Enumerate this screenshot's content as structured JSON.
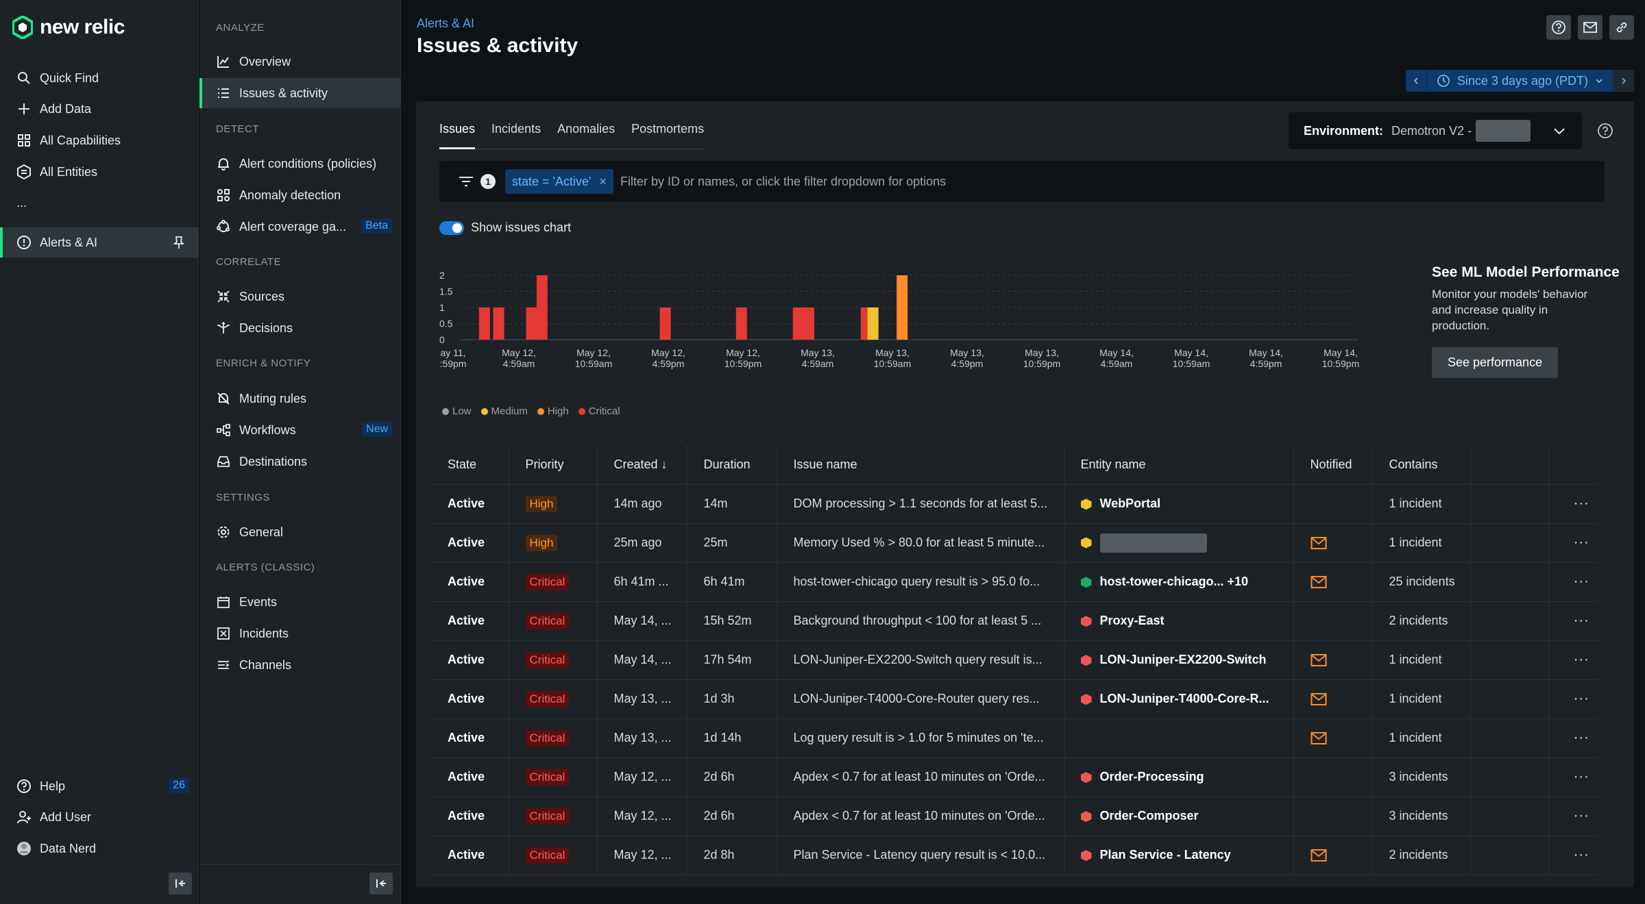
{
  "brand": {
    "name": "new relic"
  },
  "nav_primary": {
    "items": [
      {
        "label": "Quick Find",
        "icon": "search-icon"
      },
      {
        "label": "Add Data",
        "icon": "plus-icon"
      },
      {
        "label": "All Capabilities",
        "icon": "grid-icon"
      },
      {
        "label": "All Entities",
        "icon": "entities-icon"
      },
      {
        "label": "...",
        "icon": "more-icon"
      },
      {
        "label": "Alerts & AI",
        "icon": "alert-circle-icon"
      }
    ],
    "bottom": [
      {
        "label": "Help",
        "icon": "help-icon",
        "badge": "26"
      },
      {
        "label": "Add User",
        "icon": "add-user-icon"
      },
      {
        "label": "Data Nerd",
        "icon": "avatar"
      }
    ]
  },
  "nav_secondary": {
    "sections": [
      {
        "title": "ANALYZE",
        "items": [
          {
            "label": "Overview",
            "icon": "chart-icon"
          },
          {
            "label": "Issues & activity",
            "icon": "list-icon"
          }
        ]
      },
      {
        "title": "DETECT",
        "items": [
          {
            "label": "Alert conditions (policies)",
            "icon": "bell-icon"
          },
          {
            "label": "Anomaly detection",
            "icon": "anomaly-icon"
          },
          {
            "label": "Alert coverage ga...",
            "icon": "coverage-icon",
            "tag": "Beta"
          }
        ]
      },
      {
        "title": "CORRELATE",
        "items": [
          {
            "label": "Sources",
            "icon": "sources-icon"
          },
          {
            "label": "Decisions",
            "icon": "decisions-icon"
          }
        ]
      },
      {
        "title": "ENRICH & NOTIFY",
        "items": [
          {
            "label": "Muting rules",
            "icon": "bell-off-icon"
          },
          {
            "label": "Workflows",
            "icon": "workflow-icon",
            "tag": "New"
          },
          {
            "label": "Destinations",
            "icon": "inbox-icon"
          }
        ]
      },
      {
        "title": "SETTINGS",
        "items": [
          {
            "label": "General",
            "icon": "gear-icon"
          }
        ]
      },
      {
        "title": "ALERTS (CLASSIC)",
        "items": [
          {
            "label": "Events",
            "icon": "calendar-icon"
          },
          {
            "label": "Incidents",
            "icon": "incident-icon"
          },
          {
            "label": "Channels",
            "icon": "channels-icon"
          }
        ]
      }
    ]
  },
  "header": {
    "breadcrumb": "Alerts & AI",
    "title": "Issues & activity",
    "time_range": "Since 3 days ago (PDT)"
  },
  "tabs": [
    "Issues",
    "Incidents",
    "Anomalies",
    "Postmortems"
  ],
  "environment": {
    "label": "Environment:",
    "value": "Demotron V2 -"
  },
  "filter": {
    "count": "1",
    "chip": "state = 'Active'",
    "placeholder": "Filter by ID or names, or click the filter dropdown for options"
  },
  "toggle": {
    "label": "Show issues chart",
    "on": true
  },
  "promo": {
    "title": "See ML Model Performance",
    "description": "Monitor your models' behavior and increase quality in production.",
    "button": "See performance"
  },
  "colors": {
    "accent": "#1ce783",
    "link": "#4aa3ff",
    "low": "#9aa0a6",
    "medium": "#f2c12e",
    "high": "#ff8b2b",
    "critical": "#e53935"
  },
  "chart_data": {
    "type": "bar",
    "y_ticks": [
      "2",
      "1.5",
      "1",
      "0.5",
      "0"
    ],
    "ylim": [
      0,
      2
    ],
    "x_ticks": [
      [
        "ay 11,",
        ":59pm"
      ],
      [
        "May 12,",
        "4:59am"
      ],
      [
        "May 12,",
        "10:59am"
      ],
      [
        "May 12,",
        "4:59pm"
      ],
      [
        "May 12,",
        "10:59pm"
      ],
      [
        "May 13,",
        "4:59am"
      ],
      [
        "May 13,",
        "10:59am"
      ],
      [
        "May 13,",
        "4:59pm"
      ],
      [
        "May 13,",
        "10:59pm"
      ],
      [
        "May 14,",
        "4:59am"
      ],
      [
        "May 14,",
        "10:59am"
      ],
      [
        "May 14,",
        "4:59pm"
      ],
      [
        "May 14,",
        "10:59pm"
      ]
    ],
    "bars": [
      {
        "x": 0.54,
        "value": 1,
        "level": "critical"
      },
      {
        "x": 0.73,
        "value": 1,
        "level": "critical"
      },
      {
        "x": 1.17,
        "value": 1,
        "level": "critical"
      },
      {
        "x": 1.31,
        "value": 2,
        "level": "critical"
      },
      {
        "x": 2.96,
        "value": 1,
        "level": "critical"
      },
      {
        "x": 3.98,
        "value": 1,
        "level": "critical"
      },
      {
        "x": 4.74,
        "value": 1,
        "level": "critical"
      },
      {
        "x": 4.88,
        "value": 1,
        "level": "critical"
      },
      {
        "x": 5.65,
        "value": 1,
        "level": "critical"
      },
      {
        "x": 5.74,
        "value": 1,
        "level": "medium"
      },
      {
        "x": 6.13,
        "value": 2,
        "level": "high"
      }
    ],
    "legend": [
      {
        "label": "Low",
        "level": "low"
      },
      {
        "label": "Medium",
        "level": "medium"
      },
      {
        "label": "High",
        "level": "high"
      },
      {
        "label": "Critical",
        "level": "critical"
      }
    ]
  },
  "table": {
    "columns": [
      "State",
      "Priority",
      "Created ↓",
      "Duration",
      "Issue name",
      "Entity name",
      "Notified",
      "Contains"
    ],
    "rows": [
      {
        "state": "Active",
        "priority": "High",
        "created": "14m ago",
        "duration": "14m",
        "issue": "DOM processing > 1.1 seconds for at least 5...",
        "entity": "WebPortal",
        "entity_color": "#f2c12e",
        "notified": false,
        "contains": "1 incident"
      },
      {
        "state": "Active",
        "priority": "High",
        "created": "25m ago",
        "duration": "25m",
        "issue": "Memory Used % > 80.0 for at least 5 minute...",
        "entity": "",
        "entity_color": "#f2c12e",
        "redacted": true,
        "notified": true,
        "contains": "1 incident"
      },
      {
        "state": "Active",
        "priority": "Critical",
        "created": "6h 41m ...",
        "duration": "6h 41m",
        "issue": "host-tower-chicago query result is > 95.0 fo...",
        "entity": "host-tower-chicago... +10",
        "entity_color": "#1ea865",
        "notified": true,
        "contains": "25 incidents"
      },
      {
        "state": "Active",
        "priority": "Critical",
        "created": "May 14, ...",
        "duration": "15h 52m",
        "issue": "Background throughput < 100 for at least 5 ...",
        "entity": "Proxy-East",
        "entity_color": "#f0574f",
        "notified": false,
        "contains": "2 incidents"
      },
      {
        "state": "Active",
        "priority": "Critical",
        "created": "May 14, ...",
        "duration": "17h 54m",
        "issue": "LON-Juniper-EX2200-Switch query result is...",
        "entity": "LON-Juniper-EX2200-Switch",
        "entity_color": "#f0574f",
        "notified": true,
        "contains": "1 incident"
      },
      {
        "state": "Active",
        "priority": "Critical",
        "created": "May 13, ...",
        "duration": "1d 3h",
        "issue": "LON-Juniper-T4000-Core-Router query res...",
        "entity": "LON-Juniper-T4000-Core-R...",
        "entity_color": "#f0574f",
        "notified": true,
        "contains": "1 incident"
      },
      {
        "state": "Active",
        "priority": "Critical",
        "created": "May 13, ...",
        "duration": "1d 14h",
        "issue": "Log query result is > 1.0 for 5 minutes on 'te...",
        "entity": "",
        "entity_color": "",
        "notified": true,
        "contains": "1 incident"
      },
      {
        "state": "Active",
        "priority": "Critical",
        "created": "May 12, ...",
        "duration": "2d 6h",
        "issue": "Apdex < 0.7 for at least 10 minutes on 'Orde...",
        "entity": "Order-Processing",
        "entity_color": "#f0574f",
        "notified": false,
        "contains": "3 incidents"
      },
      {
        "state": "Active",
        "priority": "Critical",
        "created": "May 12, ...",
        "duration": "2d 6h",
        "issue": "Apdex < 0.7 for at least 10 minutes on 'Orde...",
        "entity": "Order-Composer",
        "entity_color": "#f0574f",
        "notified": false,
        "contains": "3 incidents"
      },
      {
        "state": "Active",
        "priority": "Critical",
        "created": "May 12, ...",
        "duration": "2d 8h",
        "issue": "Plan Service - Latency query result is < 10.0...",
        "entity": "Plan Service - Latency",
        "entity_color": "#f0574f",
        "notified": true,
        "contains": "2 incidents"
      }
    ]
  }
}
